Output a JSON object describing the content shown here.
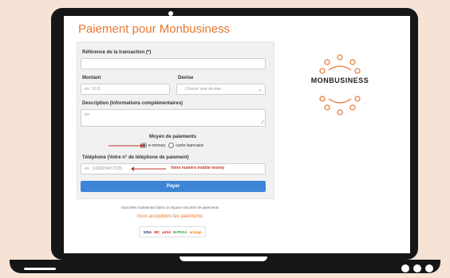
{
  "page": {
    "title": "Paiement pour Monbusiness",
    "brand": "MONBUSINESS"
  },
  "form": {
    "reference_label": "Référence de la transaction (*)",
    "reference_value": "",
    "amount_label": "Montant",
    "amount_placeholder": "ex: 10.5",
    "currency_label": "Devise",
    "currency_selected": "Choisir une devise",
    "description_label": "Description (Informations complémentaires)",
    "description_placeholder": "ex:",
    "payment_means_label": "Moyen de paiements",
    "option_emoney": "e-money",
    "option_card": "carte bancaire",
    "phone_label": "Téléphone (Votre n° de téléphone de paiement)",
    "phone_placeholder": "ex : 243823457225",
    "phone_hint": "Votre numéro mobile money",
    "submit_label": "Payer"
  },
  "footer": {
    "secure_text": "Vous êtes maintenant dans un espace sécurisé de paiements",
    "accept_text": "nous acceptions les paiements",
    "card_logos": [
      "VISA",
      "MC",
      "airtel",
      "M-PESA",
      "orange"
    ]
  },
  "colors": {
    "accent": "#e8772e",
    "button": "#3d84d6",
    "hint": "#c0392b",
    "background": "#f7e3d6"
  }
}
